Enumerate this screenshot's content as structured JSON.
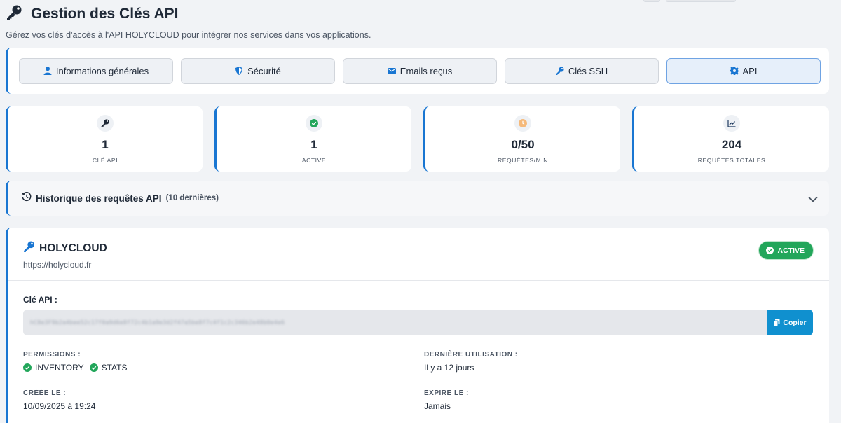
{
  "header": {
    "title": "Gestion des Clés API",
    "subtitle": "Gérez vos clés d'accès à l'API HOLYCLOUD pour intégrer nos services dans vos applications."
  },
  "tabs": [
    {
      "label": "Informations générales",
      "icon": "user-icon"
    },
    {
      "label": "Sécurité",
      "icon": "shield-icon"
    },
    {
      "label": "Emails reçus",
      "icon": "envelope-icon"
    },
    {
      "label": "Clés SSH",
      "icon": "key-icon"
    },
    {
      "label": "API",
      "icon": "gear-icon",
      "active": true
    }
  ],
  "stats": [
    {
      "value": "1",
      "label": "CLÉ API",
      "icon": "key-icon"
    },
    {
      "value": "1",
      "label": "ACTIVE",
      "icon": "check-circle-icon"
    },
    {
      "value": "0/50",
      "label": "REQUÊTES/MIN",
      "icon": "clock-icon"
    },
    {
      "value": "204",
      "label": "REQUÊTES TOTALES",
      "icon": "chart-line-icon"
    }
  ],
  "history": {
    "title": "Historique des requêtes API",
    "subtitle": "(10 dernières)"
  },
  "key_card": {
    "name": "HOLYCLOUD",
    "url": "https://holycloud.fr",
    "status": "ACTIVE",
    "key_label": "Clé API :",
    "key_value": "hC8e3F9b2a4bee52c17f0a9d6e8f72c4b1a9e3d2f47a5be8f7c4f1c2c346b2e48b0e4e6",
    "copy_label": "Copier",
    "permissions_label": "PERMISSIONS :",
    "permissions": [
      "INVENTORY",
      "STATS"
    ],
    "last_used_label": "DERNIÈRE UTILISATION :",
    "last_used_value": "Il y a 12 jours",
    "created_label": "CRÉÉE LE :",
    "created_value": "10/09/2025 à 19:24",
    "expires_label": "EXPIRE LE :",
    "expires_value": "Jamais"
  },
  "colors": {
    "accent": "#1976d2",
    "success": "#22a65a",
    "copy_button": "#1090cf",
    "background": "#f1f3f6"
  }
}
